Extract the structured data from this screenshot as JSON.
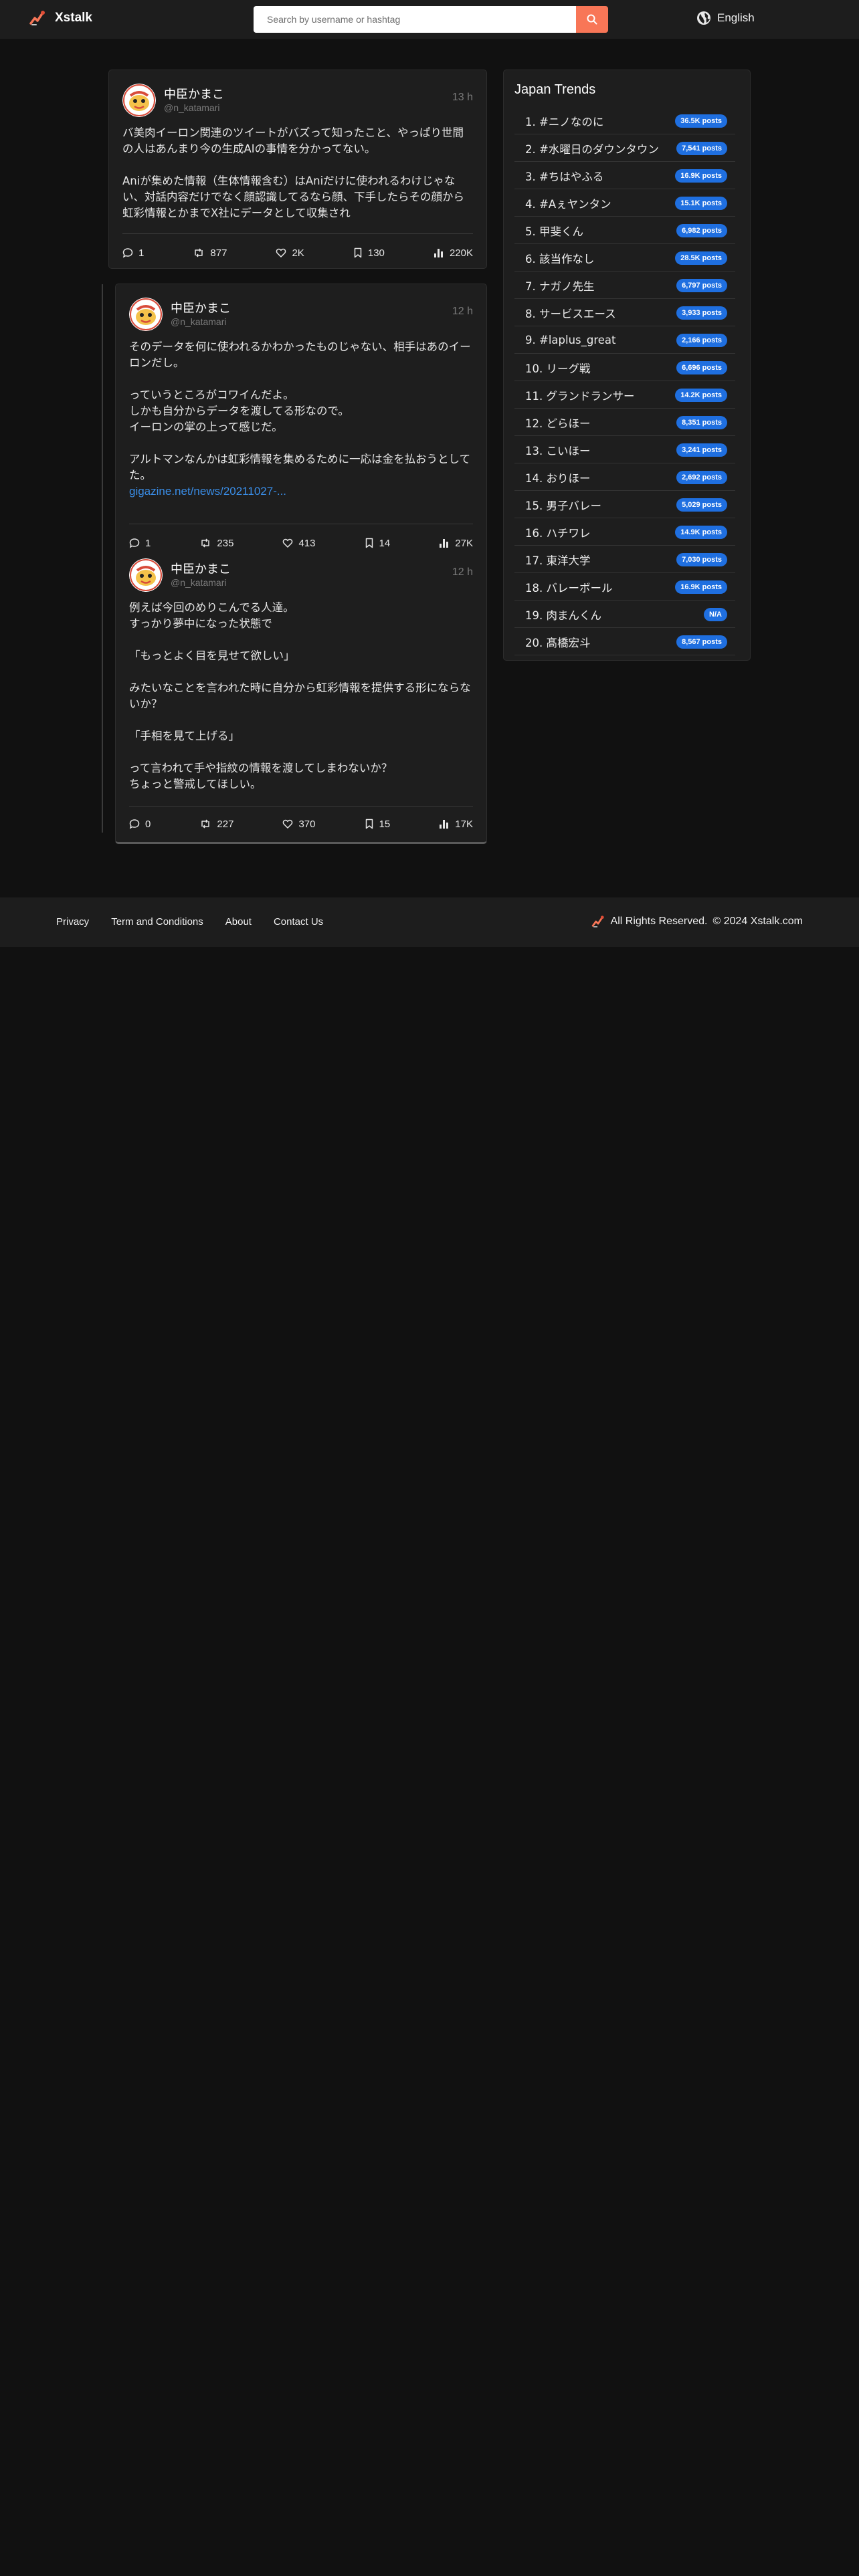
{
  "header": {
    "brand": "Xstalk",
    "search_placeholder": "Search by username or hashtag",
    "language": "English"
  },
  "colors": {
    "accent": "#f87657",
    "badge": "#1f6fe0",
    "link": "#3a8ee8"
  },
  "main_tweet": {
    "author": "中臣かまこ",
    "handle": "@n_katamari",
    "time": "13 h",
    "text": [
      "バ美肉イーロン関連のツイートがバズって知ったこと、やっぱり世間の人はあんまり今の生成AIの事情を分かってない。",
      "",
      "Aniが集めた情報（生体情報含む）はAniだけに使われるわけじゃない、対話内容だけでなく顔認識してるなら顔、下手したらその顔から虹彩情報とかまでX社にデータとして収集され"
    ],
    "stats": {
      "replies": "1",
      "retweets": "877",
      "likes": "2K",
      "bookmarks": "130",
      "views": "220K"
    }
  },
  "replies": [
    {
      "author": "中臣かまこ",
      "handle": "@n_katamari",
      "time": "12 h",
      "text": [
        "そのデータを何に使われるかわかったものじゃない、相手はあのイーロンだし。",
        "",
        "っていうところがコワイんだよ。",
        "しかも自分からデータを渡してる形なので。",
        "イーロンの掌の上って感じだ。",
        "",
        "アルトマンなんかは虹彩情報を集めるために一応は金を払おうとしてた。"
      ],
      "link": "gigazine.net/news/20211027-...",
      "stats": {
        "replies": "1",
        "retweets": "235",
        "likes": "413",
        "bookmarks": "14",
        "views": "27K"
      }
    },
    {
      "author": "中臣かまこ",
      "handle": "@n_katamari",
      "time": "12 h",
      "text": [
        "例えば今回のめりこんでる人達。",
        "すっかり夢中になった状態で",
        "",
        "「もっとよく目を見せて欲しい」",
        "",
        "みたいなことを言われた時に自分から虹彩情報を提供する形にならないか？",
        "",
        "「手相を見て上げる」",
        "",
        "って言われて手や指紋の情報を渡してしまわないか？",
        "ちょっと警戒してほしい。"
      ],
      "stats": {
        "replies": "0",
        "retweets": "227",
        "likes": "370",
        "bookmarks": "15",
        "views": "17K"
      }
    }
  ],
  "trends": {
    "title": "Japan Trends",
    "items": [
      {
        "label": "1. #ニノなのに",
        "count": "36.5K posts"
      },
      {
        "label": "2. #水曜日のダウンタウン",
        "count": "7,541 posts"
      },
      {
        "label": "3. #ちはやふる",
        "count": "16.9K posts"
      },
      {
        "label": "4. #Aぇヤンタン",
        "count": "15.1K posts"
      },
      {
        "label": "5. 甲斐くん",
        "count": "6,982 posts"
      },
      {
        "label": "6. 該当作なし",
        "count": "28.5K posts"
      },
      {
        "label": "7. ナガノ先生",
        "count": "6,797 posts"
      },
      {
        "label": "8. サービスエース",
        "count": "3,933 posts"
      },
      {
        "label": "9. #laplus_great",
        "count": "2,166 posts"
      },
      {
        "label": "10. リーグ戦",
        "count": "6,696 posts"
      },
      {
        "label": "11. グランドランサー",
        "count": "14.2K posts"
      },
      {
        "label": "12. どらほー",
        "count": "8,351 posts"
      },
      {
        "label": "13. こいほー",
        "count": "3,241 posts"
      },
      {
        "label": "14. おりほー",
        "count": "2,692 posts"
      },
      {
        "label": "15. 男子バレー",
        "count": "5,029 posts"
      },
      {
        "label": "16. ハチワレ",
        "count": "14.9K posts"
      },
      {
        "label": "17. 東洋大学",
        "count": "7,030 posts"
      },
      {
        "label": "18. バレーボール",
        "count": "16.9K posts"
      },
      {
        "label": "19. 肉まんくん",
        "count": "N/A"
      },
      {
        "label": "20. 髙橋宏斗",
        "count": "8,567 posts"
      }
    ]
  },
  "footer": {
    "links": [
      "Privacy",
      "Term and Conditions",
      "About",
      "Contact Us"
    ],
    "rights": "All Rights Reserved.",
    "copyright": "© 2024 Xstalk.com"
  }
}
